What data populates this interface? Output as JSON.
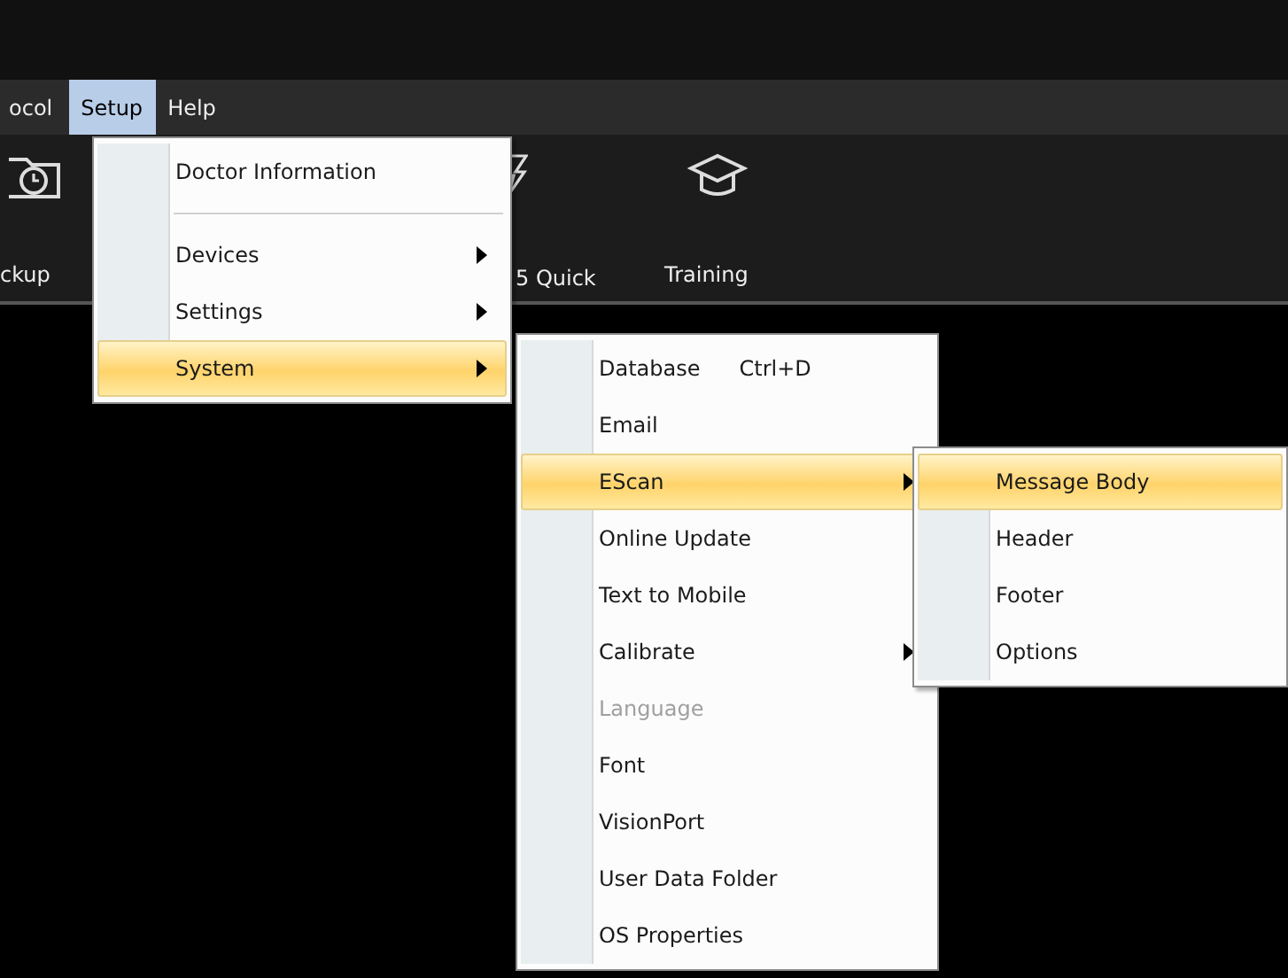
{
  "menu_bar": [
    {
      "label": "ocol",
      "selected": false
    },
    {
      "label": "Setup",
      "selected": true
    },
    {
      "label": "Help",
      "selected": false
    }
  ],
  "toolbar": [
    {
      "label": "ckup"
    },
    {
      "label": "5 Quick"
    },
    {
      "label": "Training"
    }
  ],
  "menus": [
    {
      "items": [
        {
          "kind": "item",
          "label": "Doctor Information",
          "submenu": false,
          "selected": false,
          "disabled": false
        },
        {
          "kind": "separator"
        },
        {
          "kind": "item",
          "label": "Devices",
          "submenu": true,
          "selected": false,
          "disabled": false
        },
        {
          "kind": "item",
          "label": "Settings",
          "submenu": true,
          "selected": false,
          "disabled": false
        },
        {
          "kind": "item",
          "label": "System",
          "submenu": true,
          "selected": true,
          "disabled": false
        }
      ]
    },
    {
      "items": [
        {
          "kind": "item",
          "label": "Database",
          "shortcut": "Ctrl+D",
          "submenu": false,
          "selected": false,
          "disabled": false
        },
        {
          "kind": "item",
          "label": "Email",
          "submenu": false,
          "selected": false,
          "disabled": false
        },
        {
          "kind": "item",
          "label": "EScan",
          "submenu": true,
          "selected": true,
          "disabled": false
        },
        {
          "kind": "item",
          "label": "Online Update",
          "submenu": false,
          "selected": false,
          "disabled": false
        },
        {
          "kind": "item",
          "label": "Text to Mobile",
          "submenu": false,
          "selected": false,
          "disabled": false
        },
        {
          "kind": "item",
          "label": "Calibrate",
          "submenu": true,
          "selected": false,
          "disabled": false
        },
        {
          "kind": "item",
          "label": "Language",
          "submenu": false,
          "selected": false,
          "disabled": true
        },
        {
          "kind": "item",
          "label": "Font",
          "submenu": false,
          "selected": false,
          "disabled": false
        },
        {
          "kind": "item",
          "label": "VisionPort",
          "submenu": false,
          "selected": false,
          "disabled": false
        },
        {
          "kind": "item",
          "label": "User Data Folder",
          "submenu": false,
          "selected": false,
          "disabled": false
        },
        {
          "kind": "item",
          "label": "OS Properties",
          "submenu": false,
          "selected": false,
          "disabled": false
        }
      ]
    },
    {
      "items": [
        {
          "kind": "item",
          "label": "Message Body",
          "submenu": false,
          "selected": true,
          "disabled": false
        },
        {
          "kind": "item",
          "label": "Header",
          "submenu": false,
          "selected": false,
          "disabled": false
        },
        {
          "kind": "item",
          "label": "Footer",
          "submenu": false,
          "selected": false,
          "disabled": false
        },
        {
          "kind": "item",
          "label": "Options",
          "submenu": false,
          "selected": false,
          "disabled": false
        }
      ]
    }
  ]
}
